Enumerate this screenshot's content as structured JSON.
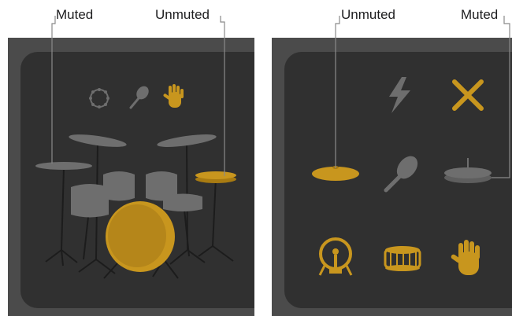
{
  "labels": {
    "left_muted": "Muted",
    "left_unmuted": "Unmuted",
    "right_unmuted": "Unmuted",
    "right_muted": "Muted"
  },
  "colors": {
    "accent_gold": "#C8961E",
    "muted_gray": "#6E6E6E",
    "panel_outer": "#4B4B4B",
    "panel_inner": "#303030",
    "leader_line": "#8A8A8A"
  },
  "left_panel": {
    "instrument_icons": [
      {
        "icon": "tambourine-icon",
        "state": "muted"
      },
      {
        "icon": "maraca-icon",
        "state": "muted"
      },
      {
        "icon": "hand-clap-icon",
        "state": "unmuted"
      }
    ],
    "kit_pieces": [
      {
        "name": "crash-cymbal",
        "state": "muted"
      },
      {
        "name": "ride-cymbal-left",
        "state": "muted"
      },
      {
        "name": "ride-cymbal-right",
        "state": "muted"
      },
      {
        "name": "hi-hat",
        "state": "unmuted"
      },
      {
        "name": "tom-1",
        "state": "muted"
      },
      {
        "name": "tom-2",
        "state": "muted"
      },
      {
        "name": "floor-tom",
        "state": "muted"
      },
      {
        "name": "floor-tom-right",
        "state": "muted"
      },
      {
        "name": "kick-drum",
        "state": "unmuted"
      }
    ]
  },
  "right_panel": {
    "pads": [
      {
        "icon": "lightning-icon",
        "state": "muted"
      },
      {
        "icon": "sticks-icon",
        "state": "unmuted"
      },
      {
        "icon": "crash-cymbal-icon",
        "state": "unmuted"
      },
      {
        "icon": "maraca-icon",
        "state": "muted"
      },
      {
        "icon": "hi-hat-icon",
        "state": "muted"
      },
      {
        "icon": "kick-drum-icon",
        "state": "unmuted"
      },
      {
        "icon": "snare-drum-icon",
        "state": "unmuted"
      },
      {
        "icon": "hand-clap-icon",
        "state": "unmuted"
      }
    ]
  }
}
